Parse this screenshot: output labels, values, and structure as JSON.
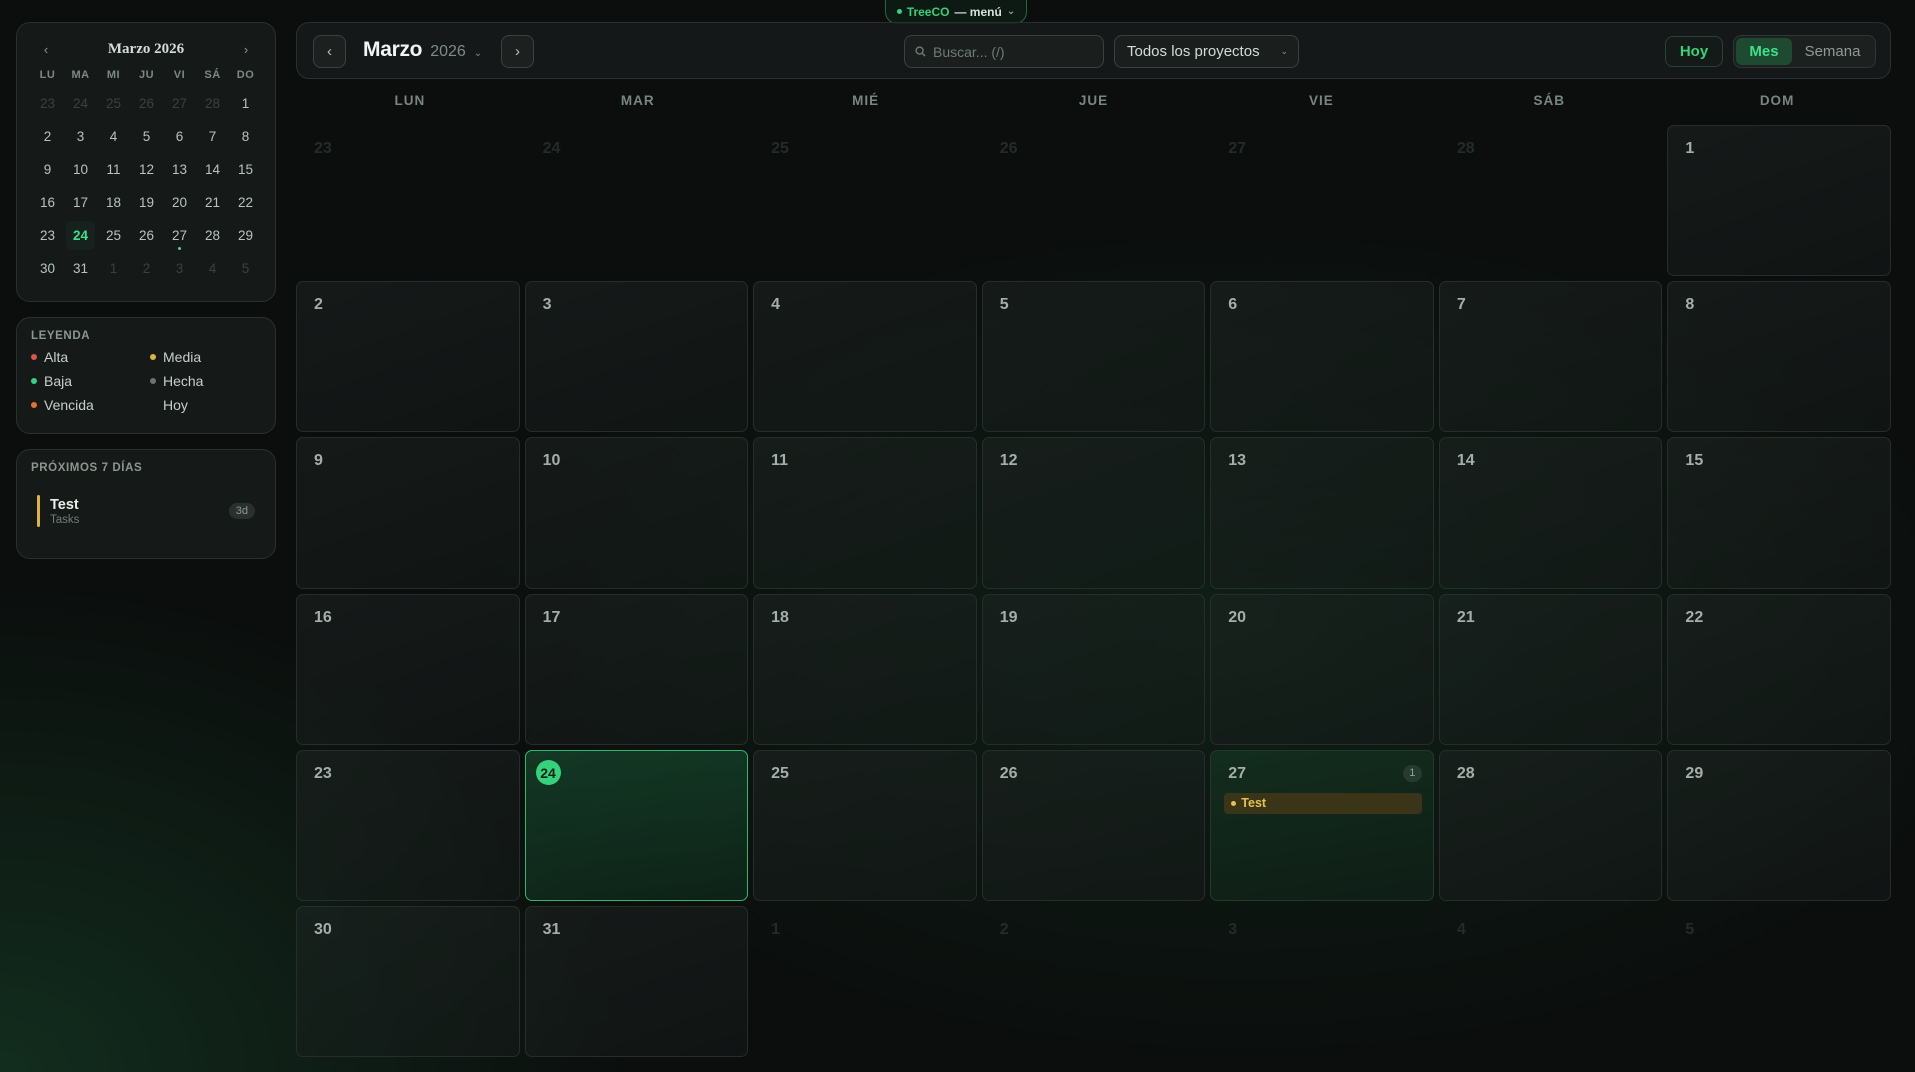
{
  "top_menu": {
    "brand": "TreeCO",
    "rest": "— menú",
    "chevron": "⌄"
  },
  "mini_calendar": {
    "title": "Marzo 2026",
    "prev": "‹",
    "next": "›",
    "weekdays": [
      "LU",
      "MA",
      "MI",
      "JU",
      "VI",
      "SÁ",
      "DO"
    ],
    "days": [
      {
        "n": "23",
        "muted": true
      },
      {
        "n": "24",
        "muted": true
      },
      {
        "n": "25",
        "muted": true
      },
      {
        "n": "26",
        "muted": true
      },
      {
        "n": "27",
        "muted": true
      },
      {
        "n": "28",
        "muted": true
      },
      {
        "n": "1"
      },
      {
        "n": "2"
      },
      {
        "n": "3"
      },
      {
        "n": "4"
      },
      {
        "n": "5"
      },
      {
        "n": "6"
      },
      {
        "n": "7"
      },
      {
        "n": "8"
      },
      {
        "n": "9"
      },
      {
        "n": "10"
      },
      {
        "n": "11"
      },
      {
        "n": "12"
      },
      {
        "n": "13"
      },
      {
        "n": "14"
      },
      {
        "n": "15"
      },
      {
        "n": "16"
      },
      {
        "n": "17"
      },
      {
        "n": "18"
      },
      {
        "n": "19"
      },
      {
        "n": "20"
      },
      {
        "n": "21"
      },
      {
        "n": "22"
      },
      {
        "n": "23"
      },
      {
        "n": "24",
        "today": true
      },
      {
        "n": "25"
      },
      {
        "n": "26"
      },
      {
        "n": "27",
        "dot": true
      },
      {
        "n": "28"
      },
      {
        "n": "29"
      },
      {
        "n": "30"
      },
      {
        "n": "31"
      },
      {
        "n": "1",
        "muted": true
      },
      {
        "n": "2",
        "muted": true
      },
      {
        "n": "3",
        "muted": true
      },
      {
        "n": "4",
        "muted": true
      },
      {
        "n": "5",
        "muted": true
      }
    ]
  },
  "legend": {
    "title": "LEYENDA",
    "items": [
      {
        "label": "Alta",
        "color": "#e0524f"
      },
      {
        "label": "Media",
        "color": "#e0b43c"
      },
      {
        "label": "Baja",
        "color": "#34d27a"
      },
      {
        "label": "Hecha",
        "color": "#6b7470"
      },
      {
        "label": "Vencida",
        "color": "#e8702e"
      },
      {
        "label": "Hoy",
        "color": ""
      }
    ]
  },
  "upcoming": {
    "title": "PRÓXIMOS 7 DÍAS",
    "items": [
      {
        "name": "Test",
        "project": "Tasks",
        "badge": "3d",
        "color": "#e0b43c"
      }
    ]
  },
  "toolbar": {
    "prev": "‹",
    "next": "›",
    "month": "Marzo",
    "year": "2026",
    "year_chevron": "⌄",
    "search_placeholder": "Buscar... (/)",
    "project_filter": "Todos los proyectos",
    "project_chevron": "⌄",
    "today_label": "Hoy",
    "view_month": "Mes",
    "view_week": "Semana"
  },
  "week_days": [
    "LUN",
    "MAR",
    "MIÉ",
    "JUE",
    "VIE",
    "SÁB",
    "DOM"
  ],
  "month_cells": [
    {
      "n": "23",
      "out": true
    },
    {
      "n": "24",
      "out": true
    },
    {
      "n": "25",
      "out": true
    },
    {
      "n": "26",
      "out": true
    },
    {
      "n": "27",
      "out": true
    },
    {
      "n": "28",
      "out": true
    },
    {
      "n": "1"
    },
    {
      "n": "2"
    },
    {
      "n": "3"
    },
    {
      "n": "4"
    },
    {
      "n": "5"
    },
    {
      "n": "6"
    },
    {
      "n": "7"
    },
    {
      "n": "8"
    },
    {
      "n": "9"
    },
    {
      "n": "10"
    },
    {
      "n": "11"
    },
    {
      "n": "12"
    },
    {
      "n": "13"
    },
    {
      "n": "14"
    },
    {
      "n": "15"
    },
    {
      "n": "16"
    },
    {
      "n": "17"
    },
    {
      "n": "18"
    },
    {
      "n": "19"
    },
    {
      "n": "20"
    },
    {
      "n": "21"
    },
    {
      "n": "22"
    },
    {
      "n": "23"
    },
    {
      "n": "24",
      "today": true
    },
    {
      "n": "25"
    },
    {
      "n": "26"
    },
    {
      "n": "27",
      "count": "1",
      "events": [
        {
          "title": "Test",
          "color": "#e6c14d"
        }
      ]
    },
    {
      "n": "28"
    },
    {
      "n": "29"
    },
    {
      "n": "30"
    },
    {
      "n": "31"
    },
    {
      "n": "1",
      "out": true
    },
    {
      "n": "2",
      "out": true
    },
    {
      "n": "3",
      "out": true
    },
    {
      "n": "4",
      "out": true
    },
    {
      "n": "5",
      "out": true
    }
  ]
}
